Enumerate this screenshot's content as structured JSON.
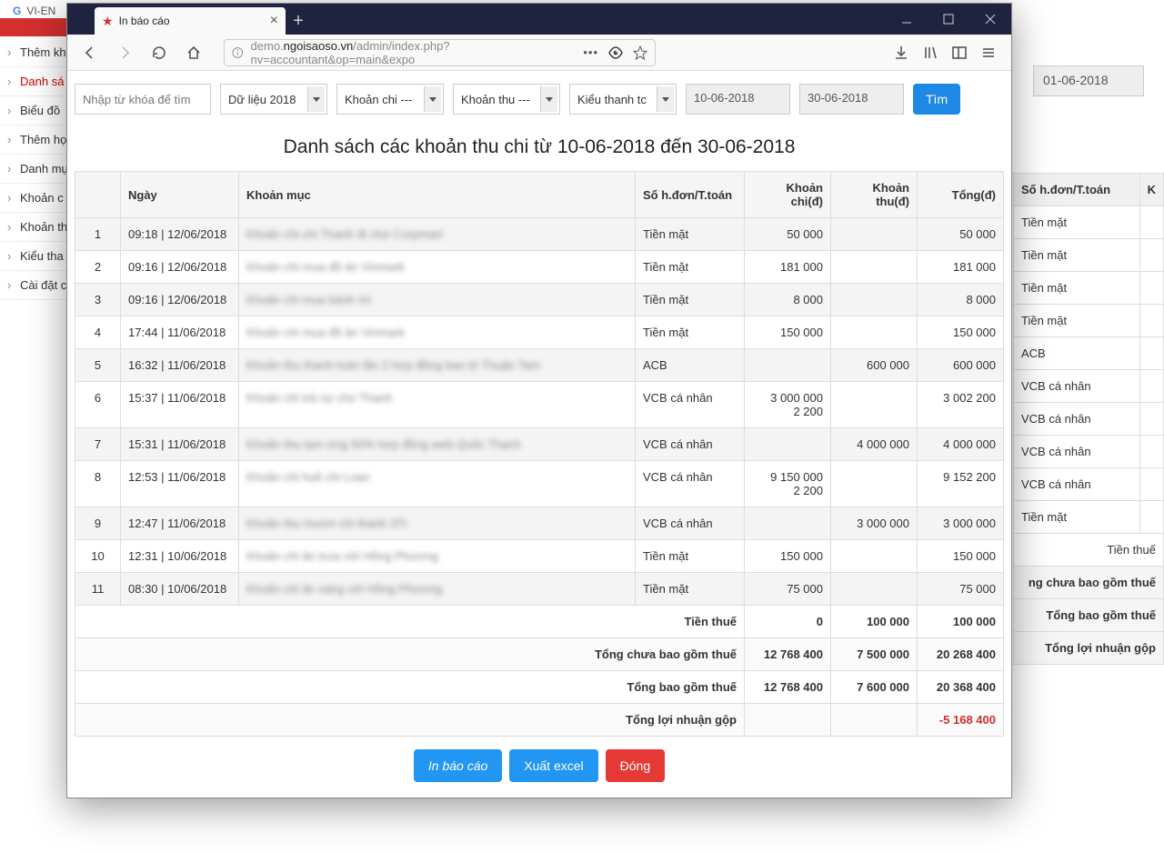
{
  "bg": {
    "lang": "VI-EN",
    "sidebar": [
      "Thêm kh",
      "Danh sá",
      "Biểu đồ",
      "Thêm họ",
      "Danh mụ",
      "Khoản c",
      "Khoản th",
      "Kiểu tha",
      "Cài đặt c"
    ],
    "sidebar_active": 1,
    "right_date": "01-06-2018",
    "table_headers": [
      "Số h.đơn/T.toán",
      "K"
    ],
    "table_rows": [
      "Tiền mặt",
      "Tiền mặt",
      "Tiền mặt",
      "Tiền mặt",
      "ACB",
      "VCB cá nhân",
      "VCB cá nhân",
      "VCB cá nhân",
      "VCB cá nhân",
      "Tiền mặt"
    ],
    "summary": [
      "Tiền thuế",
      "ng chưa bao gồm thuế",
      "Tổng bao gồm thuế",
      "Tổng lợi nhuận gộp"
    ]
  },
  "browser": {
    "tab_title": "In báo cáo",
    "url_prefix": "demo.",
    "url_domain": "ngoisaoso.vn",
    "url_path": "/admin/index.php?nv=accountant&op=main&expo"
  },
  "filters": {
    "search_placeholder": "Nhập từ khóa để tìm",
    "year": "Dữ liệu 2018",
    "chi": "Khoản chi ---",
    "thu": "Khoản thu ---",
    "tt": "Kiểu thanh tc",
    "date_from": "10-06-2018",
    "date_to": "30-06-2018",
    "search_btn": "Tìm"
  },
  "report": {
    "title": "Danh sách các khoản thu chi từ 10-06-2018 đến 30-06-2018",
    "headers": {
      "idx": "",
      "date": "Ngày",
      "item": "Khoản mục",
      "method": "Số h.đơn/T.toán",
      "chi": "Khoản chi(đ)",
      "thu": "Khoản thu(đ)",
      "total": "Tổng(đ)"
    },
    "rows": [
      {
        "idx": "1",
        "date": "09:18 | 12/06/2018",
        "item": "Khoản chi chi Thanh đi chợ Corpmart",
        "method": "Tiền mặt",
        "chi": "50 000",
        "thu": "",
        "total": "50 000"
      },
      {
        "idx": "2",
        "date": "09:16 | 12/06/2018",
        "item": "Khoản chi mua đồ ăn Vinmark",
        "method": "Tiền mặt",
        "chi": "181 000",
        "thu": "",
        "total": "181 000"
      },
      {
        "idx": "3",
        "date": "09:16 | 12/06/2018",
        "item": "Khoản chi mua bánh mì",
        "method": "Tiền mặt",
        "chi": "8 000",
        "thu": "",
        "total": "8 000"
      },
      {
        "idx": "4",
        "date": "17:44 | 11/06/2018",
        "item": "Khoản chi mua đồ ăn Vinmark",
        "method": "Tiền mặt",
        "chi": "150 000",
        "thu": "",
        "total": "150 000"
      },
      {
        "idx": "5",
        "date": "16:32 | 11/06/2018",
        "item": "Khoản thu thanh toán lần 2 hợp đồng bao bì Thuận Tam",
        "method": "ACB",
        "chi": "",
        "thu": "600 000",
        "total": "600 000"
      },
      {
        "idx": "6",
        "date": "15:37 | 11/06/2018",
        "item": "Khoản chi trả nợ cho Thanh",
        "method": "VCB cá nhân",
        "chi": "3 000 000\n2 200",
        "thu": "",
        "total": "3 002 200"
      },
      {
        "idx": "7",
        "date": "15:31 | 11/06/2018",
        "item": "Khoản thu tạm ứng 50% hợp đồng web Quốc Thạch",
        "method": "VCB cá nhân",
        "chi": "",
        "thu": "4 000 000",
        "total": "4 000 000"
      },
      {
        "idx": "8",
        "date": "12:53 | 11/06/2018",
        "item": "Khoản chi huê chi Loan",
        "method": "VCB cá nhân",
        "chi": "9 150 000\n2 200",
        "thu": "",
        "total": "9 152 200"
      },
      {
        "idx": "9",
        "date": "12:47 | 11/06/2018",
        "item": "Khoản thu mượn chi thanh 3Tr",
        "method": "VCB cá nhân",
        "chi": "",
        "thu": "3 000 000",
        "total": "3 000 000"
      },
      {
        "idx": "10",
        "date": "12:31 | 10/06/2018",
        "item": "Khoản chi ăn trưa với Hồng Phương",
        "method": "Tiền mặt",
        "chi": "150 000",
        "thu": "",
        "total": "150 000"
      },
      {
        "idx": "11",
        "date": "08:30 | 10/06/2018",
        "item": "Khoản chi ăn sáng với Hồng Phương",
        "method": "Tiền mặt",
        "chi": "75 000",
        "thu": "",
        "total": "75 000"
      }
    ],
    "summary": [
      {
        "label": "Tiền thuế",
        "chi": "0",
        "thu": "100 000",
        "total": "100 000"
      },
      {
        "label": "Tổng chưa bao gồm thuế",
        "chi": "12 768 400",
        "thu": "7 500 000",
        "total": "20 268 400"
      },
      {
        "label": "Tổng bao gồm thuế",
        "chi": "12 768 400",
        "thu": "7 600 000",
        "total": "20 368 400"
      },
      {
        "label": "Tổng lợi nhuận gộp",
        "chi": "",
        "thu": "",
        "total": "-5 168 400",
        "neg": true
      }
    ],
    "actions": {
      "print": "In báo cáo",
      "excel": "Xuất excel",
      "close": "Đóng"
    }
  }
}
